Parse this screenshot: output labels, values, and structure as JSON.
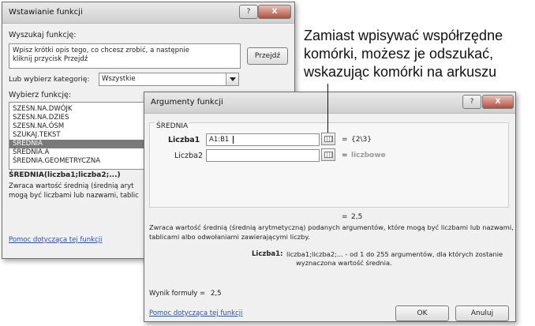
{
  "insert_dialog": {
    "title": "Wstawianie funkcji",
    "help_btn": "?",
    "close_btn": "X",
    "search_label": "Wyszukaj funkcję:",
    "search_text": "Wpisz krótki opis tego, co chcesz zrobić, a następnie kliknij przycisk Przejdź",
    "go_button": "Przejdź",
    "category_label": "Lub wybierz kategorię:",
    "category_value": "Wszystkie",
    "select_label": "Wybierz funkcję:",
    "functions": [
      "SZESN.NA.DWÓJK",
      "SZESN.NA.DZIES",
      "SZESN.NA.ÓSM",
      "SZUKAJ.TEKST",
      "ŚREDNIA",
      "ŚREDNIA.A",
      "ŚREDNIA.GEOMETRYCZNA"
    ],
    "selected_index": 4,
    "signature": "ŚREDNIA(liczba1;liczba2;...)",
    "description_line1": "Zwraca wartość średnią (średnią aryt",
    "description_line2": "mogą być liczbami lub nazwami, tablic",
    "help_link": "Pomoc dotycząca tej funkcji"
  },
  "callout": {
    "lines": [
      "Zamiast wpisywać współrzędne",
      "komórki, możesz je odszukać,",
      "wskazując komórki na arkuszu"
    ]
  },
  "args_dialog": {
    "title": "Argumenty funkcji",
    "help_btn": "?",
    "close_btn": "X",
    "group_label": "ŚREDNIA",
    "arg1_label": "Liczba1",
    "arg1_value": "A1:B1",
    "arg1_result": "{2\\3}",
    "arg2_label": "Liczba2",
    "arg2_value": "",
    "arg2_result": "liczbowe",
    "equals": "=",
    "total_result": "2,5",
    "description": "Zwraca wartość średnią (średnią arytmetyczną) podanych argumentów, które mogą być liczbami lub nazwami, tablicami albo odwołaniami zawierającymi liczby.",
    "desc_line1": "Zwraca wartość średnią (średnią arytmetyczną) podanych argumentów, które mogą być liczbami lub nazwami,",
    "desc_line2": "tablicami albo odwołaniami zawierającymi liczby.",
    "arg_help_label": "Liczba1:",
    "arg_help_line1": "liczba1;liczba2;... - od 1 do 255 argumentów, dla których zostanie",
    "arg_help_line2": "wyznaczona wartość średnia.",
    "formula_result_label": "Wynik formuły =",
    "formula_result_value": "2,5",
    "help_link": "Pomoc dotycząca tej funkcji",
    "ok_button": "OK",
    "cancel_button": "Anuluj"
  }
}
